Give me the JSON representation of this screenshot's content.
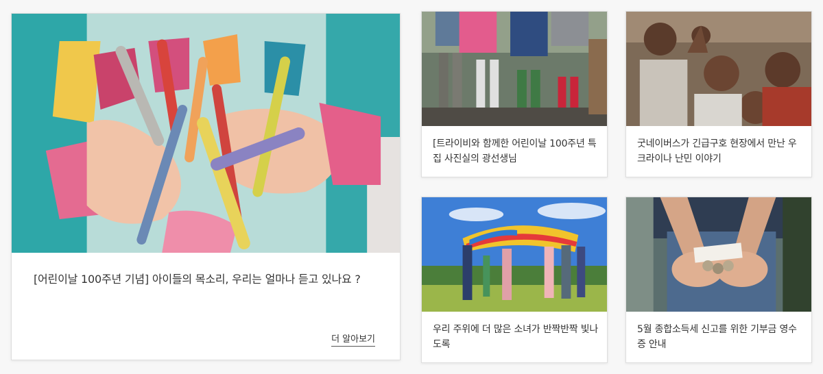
{
  "featured": {
    "title": "[어린이날 100주년 기념] 아이들의 목소리, 우리는 얼마나 듣고 있나요 ?",
    "more_label": "더 알아보기"
  },
  "cards": [
    {
      "title": "[트라이비와 함께한 어린이날 100주년 특집 사진실의 광선생님"
    },
    {
      "title": "굿네이버스가 긴급구호 현장에서 만난 우크라이나 난민 이야기"
    },
    {
      "title": "우리 주위에 더 많은 소녀가 반짝반짝 빛나도록"
    },
    {
      "title": "5월 종합소득세 신고를 위한 기부금 영수증 안내"
    }
  ]
}
